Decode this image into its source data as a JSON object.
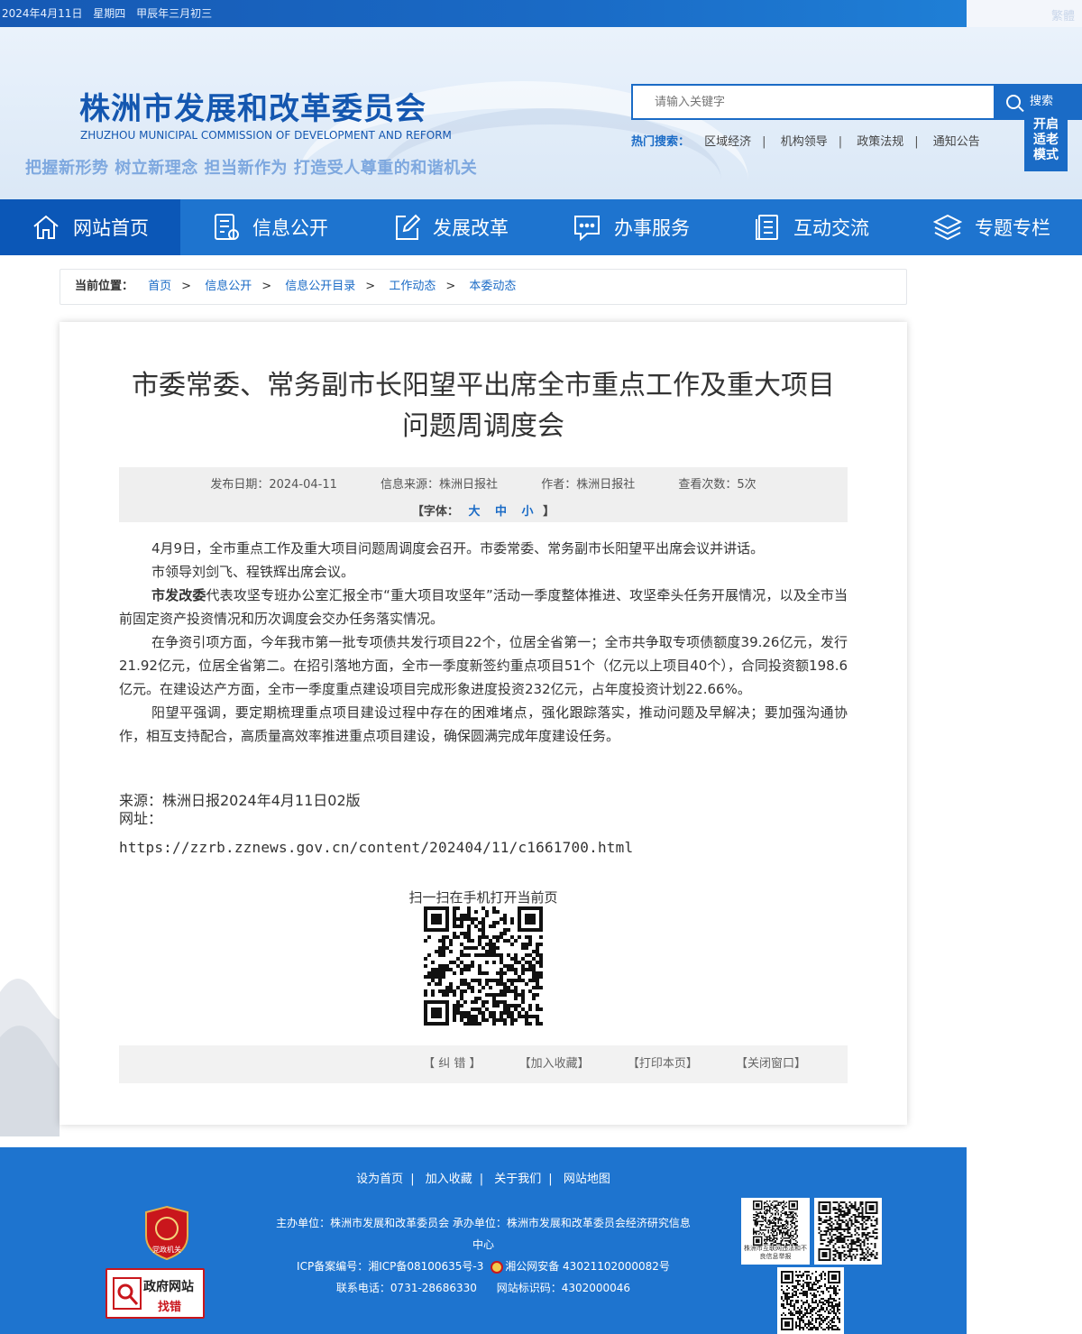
{
  "topbar": {
    "date": "2024年4月11日",
    "weekday": "星期四",
    "lunar": "甲辰年三月初三",
    "traditional": "繁體"
  },
  "header": {
    "title": "株洲市发展和改革委员会",
    "subtitle": "ZHUZHOU MUNICIPAL COMMISSION OF DEVELOPMENT AND REFORM",
    "slogan": "把握新形势 树立新理念 担当新作为 打造受人尊重的和谐机关",
    "search_placeholder": "请输入关键字",
    "search_button": "搜索",
    "hot_label": "热门搜索：",
    "hot_items": [
      "区域经济",
      "机构领导",
      "政策法规",
      "通知公告"
    ],
    "elder_mode": [
      "开启",
      "适老",
      "模式"
    ]
  },
  "nav": [
    {
      "label": "网站首页",
      "icon": "home-icon"
    },
    {
      "label": "信息公开",
      "icon": "document-icon"
    },
    {
      "label": "发展改革",
      "icon": "edit-icon"
    },
    {
      "label": "办事服务",
      "icon": "chat-icon"
    },
    {
      "label": "互动交流",
      "icon": "list-icon"
    },
    {
      "label": "专题专栏",
      "icon": "layers-icon"
    }
  ],
  "breadcrumb": {
    "label": "当前位置：",
    "items": [
      "首页",
      "信息公开",
      "信息公开目录",
      "工作动态",
      "本委动态"
    ]
  },
  "article": {
    "title_line1": "市委常委、常务副市长阳望平出席全市重点工作及重大项目",
    "title_line2": "问题周调度会",
    "date": "发布日期：2024-04-11",
    "source": "信息来源：株洲日报社",
    "author": "作者：株洲日报社",
    "views": "查看次数：5次",
    "font_label": "【字体：",
    "font_large": "大",
    "font_medium": "中",
    "font_small": "小",
    "font_end": "】",
    "p1": "4月9日，全市重点工作及重大项目问题周调度会召开。市委常委、常务副市长阳望平出席会议并讲话。",
    "p2": "市领导刘剑飞、程铁辉出席会议。",
    "p3_bold": "市发改委",
    "p3": "代表攻坚专班办公室汇报全市“重大项目攻坚年”活动一季度整体推进、攻坚牵头任务开展情况，以及全市当前固定资产投资情况和历次调度会交办任务落实情况。",
    "p4": "在争资引项方面，今年我市第一批专项债共发行项目22个，位居全省第一；全市共争取专项债额度39.26亿元，发行21.92亿元，位居全省第二。在招引落地方面，全市一季度新签约重点项目51个（亿元以上项目40个），合同投资额198.6亿元。在建设达产方面，全市一季度重点建设项目完成形象进度投资232亿元，占年度投资计划22.66%。",
    "p5": "阳望平强调，要定期梳理重点项目建设过程中存在的困难堵点，强化跟踪落实，推动问题及早解决；要加强沟通协作，相互支持配合，高质量高效率推进重点项目建设，确保圆满完成年度建设任务。",
    "source_line": "来源：株洲日报2024年4月11日02版",
    "url_label": "网址：",
    "url": "https://zzrb.zznews.gov.cn/content/202404/11/c1661700.html",
    "qr_label": "扫一扫在手机打开当前页",
    "tools": [
      "【 纠 错 】",
      "【加入收藏】",
      "【打印本页】",
      "【关闭窗口】"
    ]
  },
  "footer": {
    "links": [
      "设为首页",
      "加入收藏",
      "关于我们",
      "网站地图"
    ],
    "host": "主办单位：株洲市发展和改革委员会 承办单位：株洲市发展和改革委员会经济研究信息中心",
    "icp": "ICP备案编号：湘ICP备08100635号-3",
    "police": "湘公网安备 43021102000082号",
    "phone": "联系电话：0731-28686330",
    "site_code": "网站标识码：4302000046",
    "badge_text": "党政机关",
    "gov_err_line1": "政府网站",
    "gov_err_line2": "找错",
    "qr_caption": "株洲市互联网违法和不良信息举报"
  }
}
